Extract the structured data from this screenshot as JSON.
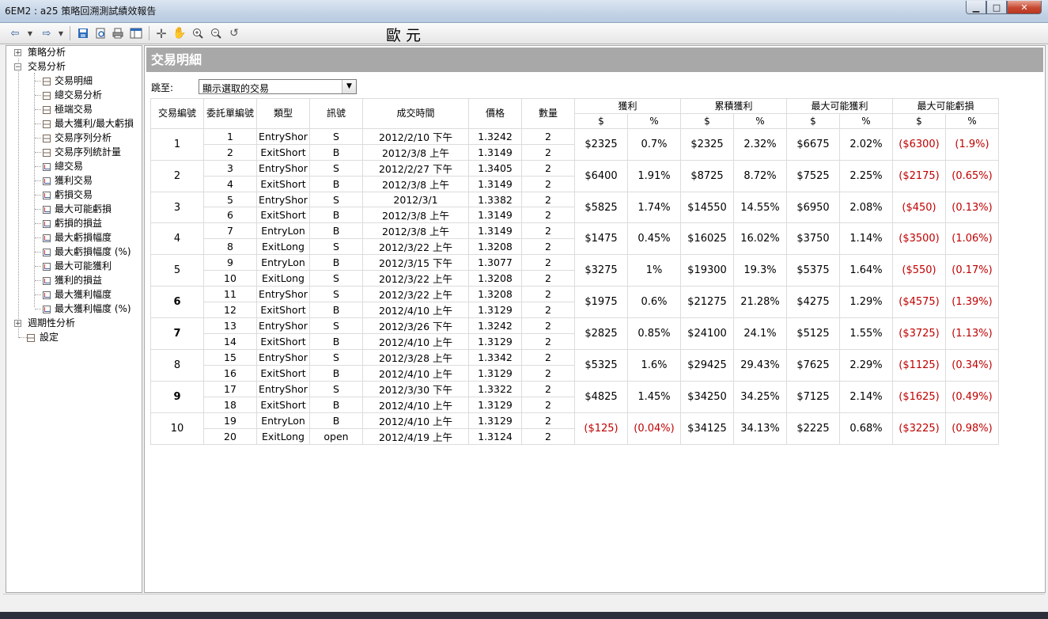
{
  "window": {
    "title": "6EM2 : a25 策略回溯測試績效報告",
    "minimize": "▁",
    "maximize": "□",
    "close": "✕"
  },
  "toolbar": {
    "currency": "歐元",
    "icons": [
      "back-icon",
      "back-dropdown-icon",
      "forward-icon",
      "forward-dropdown-icon",
      "save-icon",
      "preview-icon",
      "print-icon",
      "layout-icon",
      "crosshair-icon",
      "hand-icon",
      "zoom-in-icon",
      "zoom-out-icon",
      "refresh-icon"
    ]
  },
  "tree": {
    "groups": [
      {
        "label": "策略分析",
        "expander": "+"
      },
      {
        "label": "交易分析",
        "expander": "−"
      },
      {
        "label": "週期性分析",
        "expander": "+"
      },
      {
        "label": "設定"
      }
    ],
    "trade_items": [
      {
        "label": "交易明細",
        "icon": "table"
      },
      {
        "label": "總交易分析",
        "icon": "table"
      },
      {
        "label": "極端交易",
        "icon": "table"
      },
      {
        "label": "最大獲利/最大虧損",
        "icon": "table"
      },
      {
        "label": "交易序列分析",
        "icon": "table"
      },
      {
        "label": "交易序列統計量",
        "icon": "table"
      },
      {
        "label": "總交易",
        "icon": "chart"
      },
      {
        "label": "獲利交易",
        "icon": "chart"
      },
      {
        "label": "虧損交易",
        "icon": "chart"
      },
      {
        "label": "最大可能虧損",
        "icon": "chart"
      },
      {
        "label": "虧損的損益",
        "icon": "chart"
      },
      {
        "label": "最大虧損幅度",
        "icon": "chart"
      },
      {
        "label": "最大虧損幅度 (%)",
        "icon": "chart"
      },
      {
        "label": "最大可能獲利",
        "icon": "chart"
      },
      {
        "label": "獲利的損益",
        "icon": "chart"
      },
      {
        "label": "最大獲利幅度",
        "icon": "chart"
      },
      {
        "label": "最大獲利幅度 (%)",
        "icon": "chart"
      }
    ]
  },
  "main": {
    "section_title": "交易明細",
    "goto_label": "跳至:",
    "goto_select": "顯示選取的交易",
    "headers": {
      "trade_no": "交易編號",
      "order_no": "委託單編號",
      "type": "類型",
      "signal": "訊號",
      "time": "成交時間",
      "price": "價格",
      "qty": "數量",
      "profit": "獲利",
      "cum_profit": "累積獲利",
      "max_profit": "最大可能獲利",
      "max_loss": "最大可能虧損",
      "dollar": "$",
      "percent": "%"
    },
    "trades": [
      {
        "id": "1",
        "bold": false,
        "orders": [
          {
            "no": "1",
            "type": "EntryShor",
            "signal": "S",
            "time": "2012/2/10 下午",
            "price": "1.3242",
            "qty": "2"
          },
          {
            "no": "2",
            "type": "ExitShort",
            "signal": "B",
            "time": "2012/3/8 上午",
            "price": "1.3149",
            "qty": "2"
          }
        ],
        "p": "$2325",
        "pp": "0.7%",
        "c": "$2325",
        "cp": "2.32%",
        "mp": "$6675",
        "mpp": "2.02%",
        "ml": "($6300)",
        "mlp": "(1.9%)"
      },
      {
        "id": "2",
        "bold": false,
        "orders": [
          {
            "no": "3",
            "type": "EntryShor",
            "signal": "S",
            "time": "2012/2/27 下午",
            "price": "1.3405",
            "qty": "2"
          },
          {
            "no": "4",
            "type": "ExitShort",
            "signal": "B",
            "time": "2012/3/8 上午",
            "price": "1.3149",
            "qty": "2"
          }
        ],
        "p": "$6400",
        "pp": "1.91%",
        "c": "$8725",
        "cp": "8.72%",
        "mp": "$7525",
        "mpp": "2.25%",
        "ml": "($2175)",
        "mlp": "(0.65%)"
      },
      {
        "id": "3",
        "bold": false,
        "orders": [
          {
            "no": "5",
            "type": "EntryShor",
            "signal": "S",
            "time": "2012/3/1",
            "price": "1.3382",
            "qty": "2"
          },
          {
            "no": "6",
            "type": "ExitShort",
            "signal": "B",
            "time": "2012/3/8 上午",
            "price": "1.3149",
            "qty": "2"
          }
        ],
        "p": "$5825",
        "pp": "1.74%",
        "c": "$14550",
        "cp": "14.55%",
        "mp": "$6950",
        "mpp": "2.08%",
        "ml": "($450)",
        "mlp": "(0.13%)"
      },
      {
        "id": "4",
        "bold": false,
        "orders": [
          {
            "no": "7",
            "type": "EntryLon",
            "signal": "B",
            "time": "2012/3/8 上午",
            "price": "1.3149",
            "qty": "2"
          },
          {
            "no": "8",
            "type": "ExitLong",
            "signal": "S",
            "time": "2012/3/22 上午",
            "price": "1.3208",
            "qty": "2"
          }
        ],
        "p": "$1475",
        "pp": "0.45%",
        "c": "$16025",
        "cp": "16.02%",
        "mp": "$3750",
        "mpp": "1.14%",
        "ml": "($3500)",
        "mlp": "(1.06%)"
      },
      {
        "id": "5",
        "bold": false,
        "orders": [
          {
            "no": "9",
            "type": "EntryLon",
            "signal": "B",
            "time": "2012/3/15 下午",
            "price": "1.3077",
            "qty": "2"
          },
          {
            "no": "10",
            "type": "ExitLong",
            "signal": "S",
            "time": "2012/3/22 上午",
            "price": "1.3208",
            "qty": "2"
          }
        ],
        "p": "$3275",
        "pp": "1%",
        "c": "$19300",
        "cp": "19.3%",
        "mp": "$5375",
        "mpp": "1.64%",
        "ml": "($550)",
        "mlp": "(0.17%)"
      },
      {
        "id": "6",
        "bold": true,
        "orders": [
          {
            "no": "11",
            "type": "EntryShor",
            "signal": "S",
            "time": "2012/3/22 上午",
            "price": "1.3208",
            "qty": "2"
          },
          {
            "no": "12",
            "type": "ExitShort",
            "signal": "B",
            "time": "2012/4/10 上午",
            "price": "1.3129",
            "qty": "2"
          }
        ],
        "p": "$1975",
        "pp": "0.6%",
        "c": "$21275",
        "cp": "21.28%",
        "mp": "$4275",
        "mpp": "1.29%",
        "ml": "($4575)",
        "mlp": "(1.39%)"
      },
      {
        "id": "7",
        "bold": true,
        "orders": [
          {
            "no": "13",
            "type": "EntryShor",
            "signal": "S",
            "time": "2012/3/26 下午",
            "price": "1.3242",
            "qty": "2"
          },
          {
            "no": "14",
            "type": "ExitShort",
            "signal": "B",
            "time": "2012/4/10 上午",
            "price": "1.3129",
            "qty": "2"
          }
        ],
        "p": "$2825",
        "pp": "0.85%",
        "c": "$24100",
        "cp": "24.1%",
        "mp": "$5125",
        "mpp": "1.55%",
        "ml": "($3725)",
        "mlp": "(1.13%)"
      },
      {
        "id": "8",
        "bold": false,
        "orders": [
          {
            "no": "15",
            "type": "EntryShor",
            "signal": "S",
            "time": "2012/3/28 上午",
            "price": "1.3342",
            "qty": "2"
          },
          {
            "no": "16",
            "type": "ExitShort",
            "signal": "B",
            "time": "2012/4/10 上午",
            "price": "1.3129",
            "qty": "2"
          }
        ],
        "p": "$5325",
        "pp": "1.6%",
        "c": "$29425",
        "cp": "29.43%",
        "mp": "$7625",
        "mpp": "2.29%",
        "ml": "($1125)",
        "mlp": "(0.34%)"
      },
      {
        "id": "9",
        "bold": true,
        "orders": [
          {
            "no": "17",
            "type": "EntryShor",
            "signal": "S",
            "time": "2012/3/30 下午",
            "price": "1.3322",
            "qty": "2"
          },
          {
            "no": "18",
            "type": "ExitShort",
            "signal": "B",
            "time": "2012/4/10 上午",
            "price": "1.3129",
            "qty": "2"
          }
        ],
        "p": "$4825",
        "pp": "1.45%",
        "c": "$34250",
        "cp": "34.25%",
        "mp": "$7125",
        "mpp": "2.14%",
        "ml": "($1625)",
        "mlp": "(0.49%)"
      },
      {
        "id": "10",
        "bold": false,
        "orders": [
          {
            "no": "19",
            "type": "EntryLon",
            "signal": "B",
            "time": "2012/4/10 上午",
            "price": "1.3129",
            "qty": "2"
          },
          {
            "no": "20",
            "type": "ExitLong",
            "signal": "open",
            "time": "2012/4/19 上午",
            "price": "1.3124",
            "qty": "2"
          }
        ],
        "p": "($125)",
        "pp": "(0.04%)",
        "c": "$34125",
        "cp": "34.13%",
        "mp": "$2225",
        "mpp": "0.68%",
        "ml": "($3225)",
        "mlp": "(0.98%)"
      }
    ]
  },
  "colors": {
    "negative": "#c00000",
    "header_bar": "#a8a8a8"
  }
}
